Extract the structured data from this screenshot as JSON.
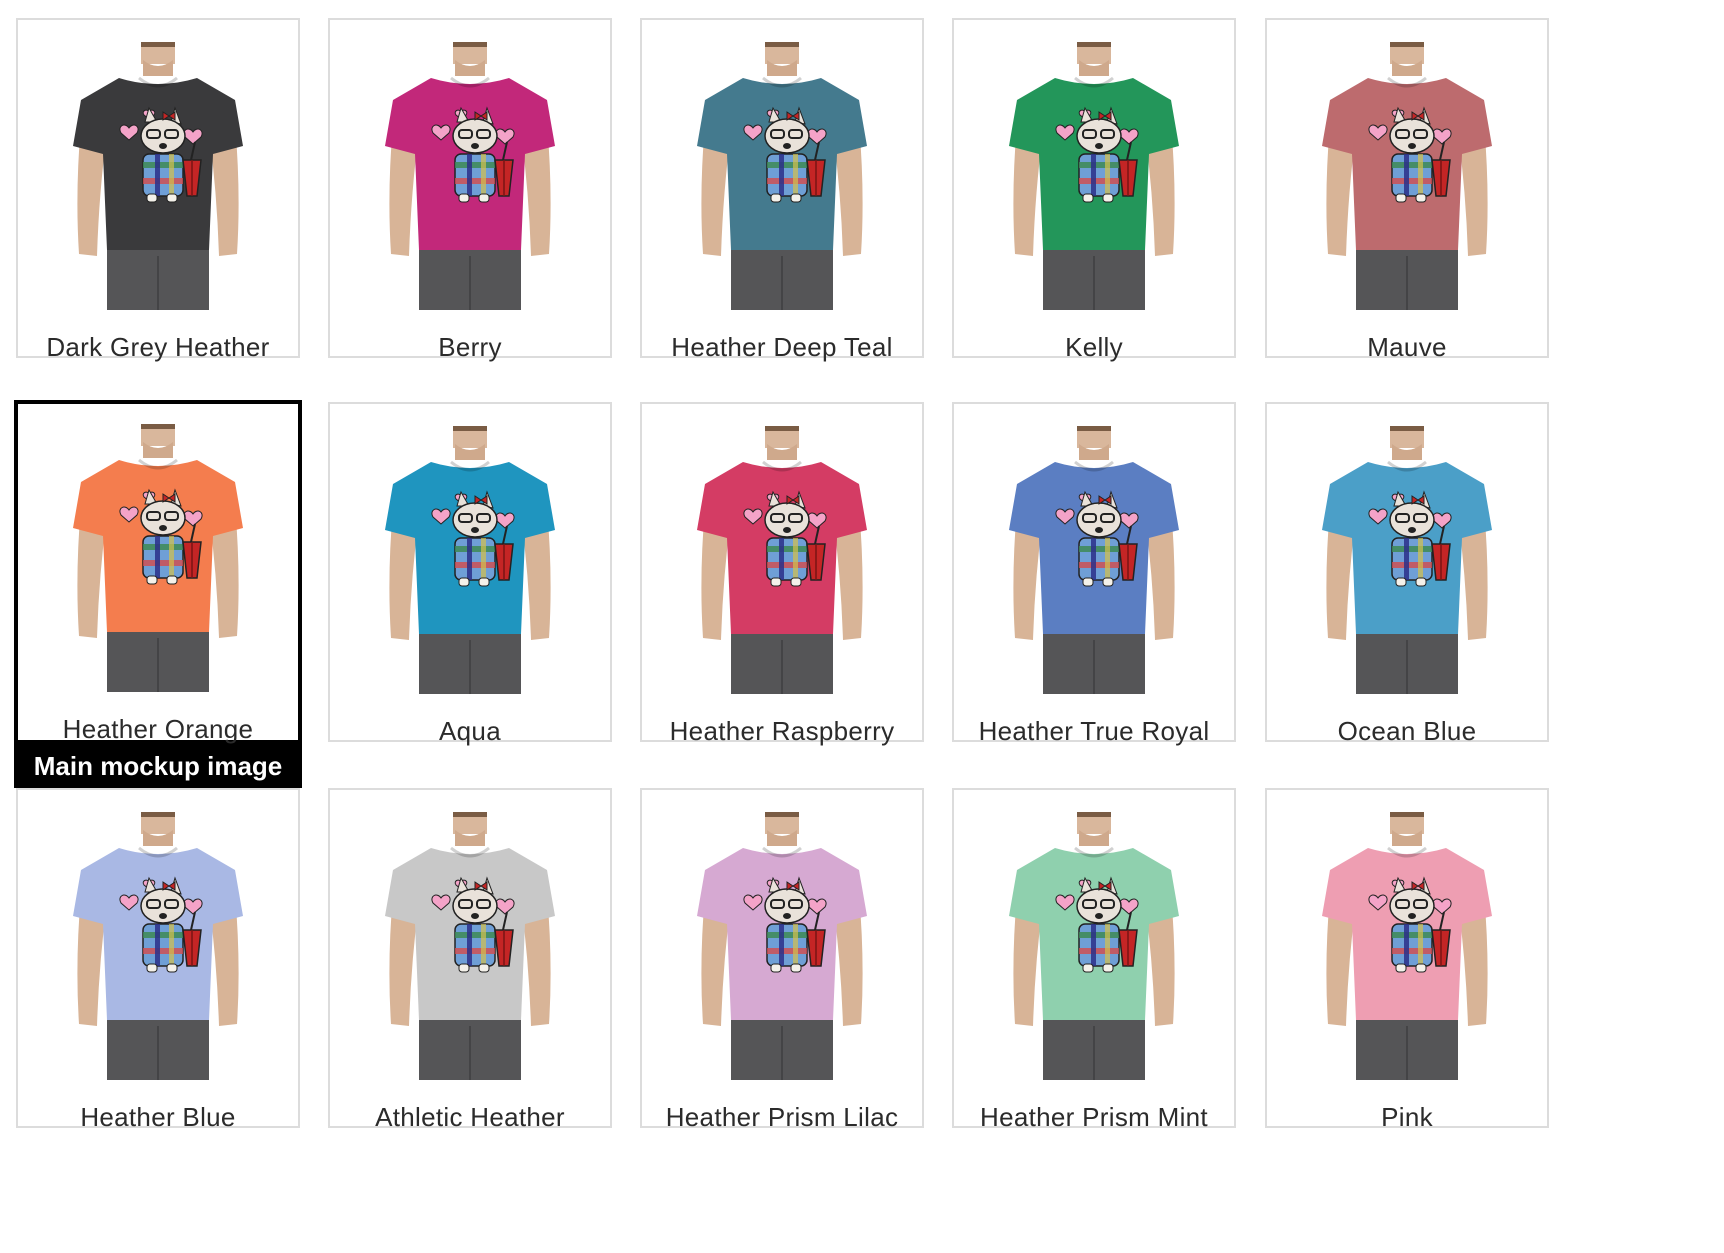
{
  "main_badge_label": "Main mockup image",
  "selected_index": 5,
  "colors": [
    {
      "name": "Dark Grey Heather",
      "hex": "#3a3a3c"
    },
    {
      "name": "Berry",
      "hex": "#c2287a"
    },
    {
      "name": "Heather Deep Teal",
      "hex": "#447a8e"
    },
    {
      "name": "Kelly",
      "hex": "#23965a"
    },
    {
      "name": "Mauve",
      "hex": "#bd6b6e"
    },
    {
      "name": "Heather Orange",
      "hex": "#f47d4e"
    },
    {
      "name": "Aqua",
      "hex": "#1f95bf"
    },
    {
      "name": "Heather Raspberry",
      "hex": "#d43c64"
    },
    {
      "name": "Heather True Royal",
      "hex": "#5b7ec2"
    },
    {
      "name": "Ocean Blue",
      "hex": "#4b9fc8"
    },
    {
      "name": "Heather Blue",
      "hex": "#a9b8e4"
    },
    {
      "name": "Athletic Heather",
      "hex": "#c8c8c8"
    },
    {
      "name": "Heather Prism Lilac",
      "hex": "#d6a9d2"
    },
    {
      "name": "Heather Prism Mint",
      "hex": "#8fd0ae"
    },
    {
      "name": "Pink",
      "hex": "#ee9eb2"
    }
  ]
}
